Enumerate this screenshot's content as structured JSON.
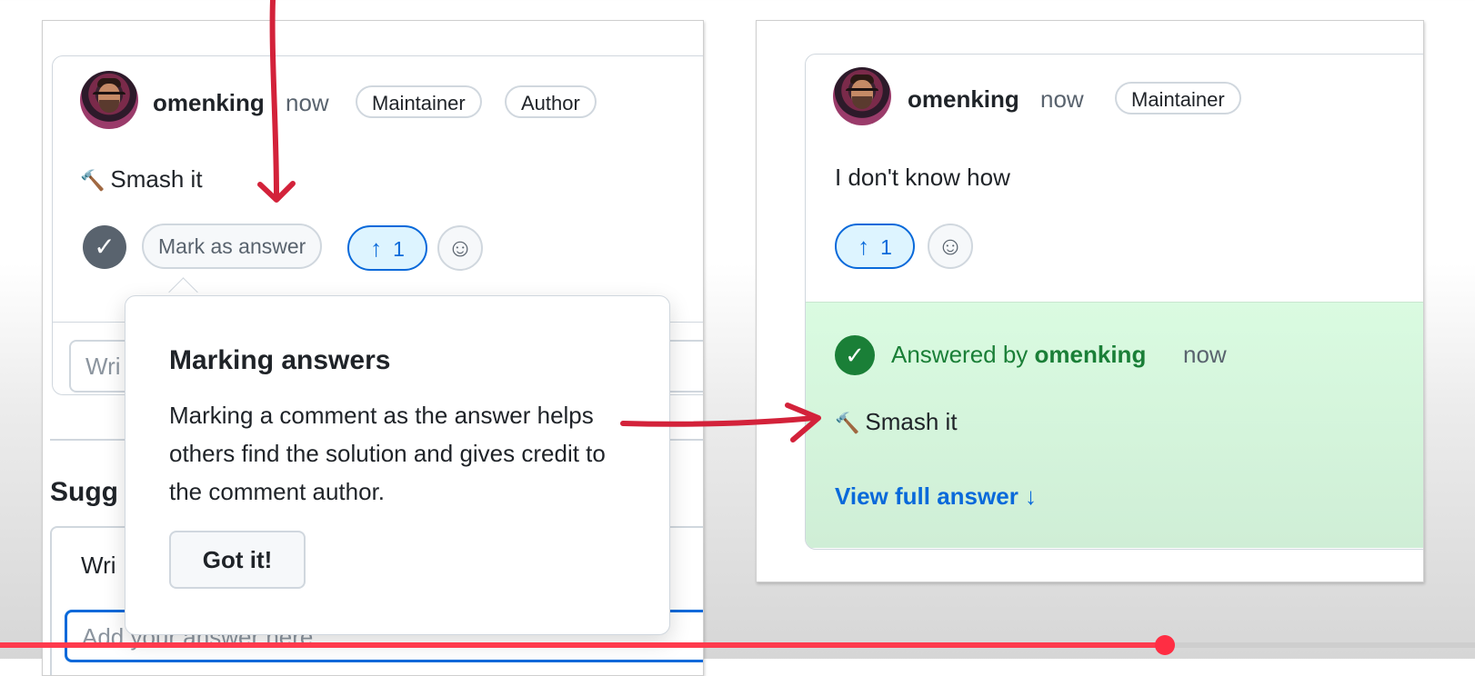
{
  "left": {
    "comment": {
      "username": "omenking",
      "time": "now",
      "tags": [
        "Maintainer",
        "Author"
      ],
      "body": "Smash it",
      "body_icon": "hammer-icon",
      "mark_answer_label": "Mark as answer",
      "upvote_count": "1"
    },
    "reply_placeholder": "Wri",
    "suggested_title": "Sugg",
    "write_tab": "Wri",
    "answer_placeholder": "Add your answer here..."
  },
  "popover": {
    "title": "Marking answers",
    "body": "Marking a comment as the answer helps others find the solution and gives credit to the comment author.",
    "button": "Got it!"
  },
  "right": {
    "comment": {
      "username": "omenking",
      "time": "now",
      "tags": [
        "Maintainer"
      ],
      "body": "I don't know how",
      "upvote_count": "1"
    },
    "answer": {
      "prefix": "Answered by ",
      "name": "omenking",
      "time": "now",
      "body": "Smash it",
      "view_full": "View full answer ↓"
    }
  },
  "colors": {
    "annotation_red": "#d3223a",
    "progress_red": "#ff3a4d",
    "accent_blue": "#0969da",
    "success_green": "#1a7f37"
  },
  "video_progress": 0.79
}
